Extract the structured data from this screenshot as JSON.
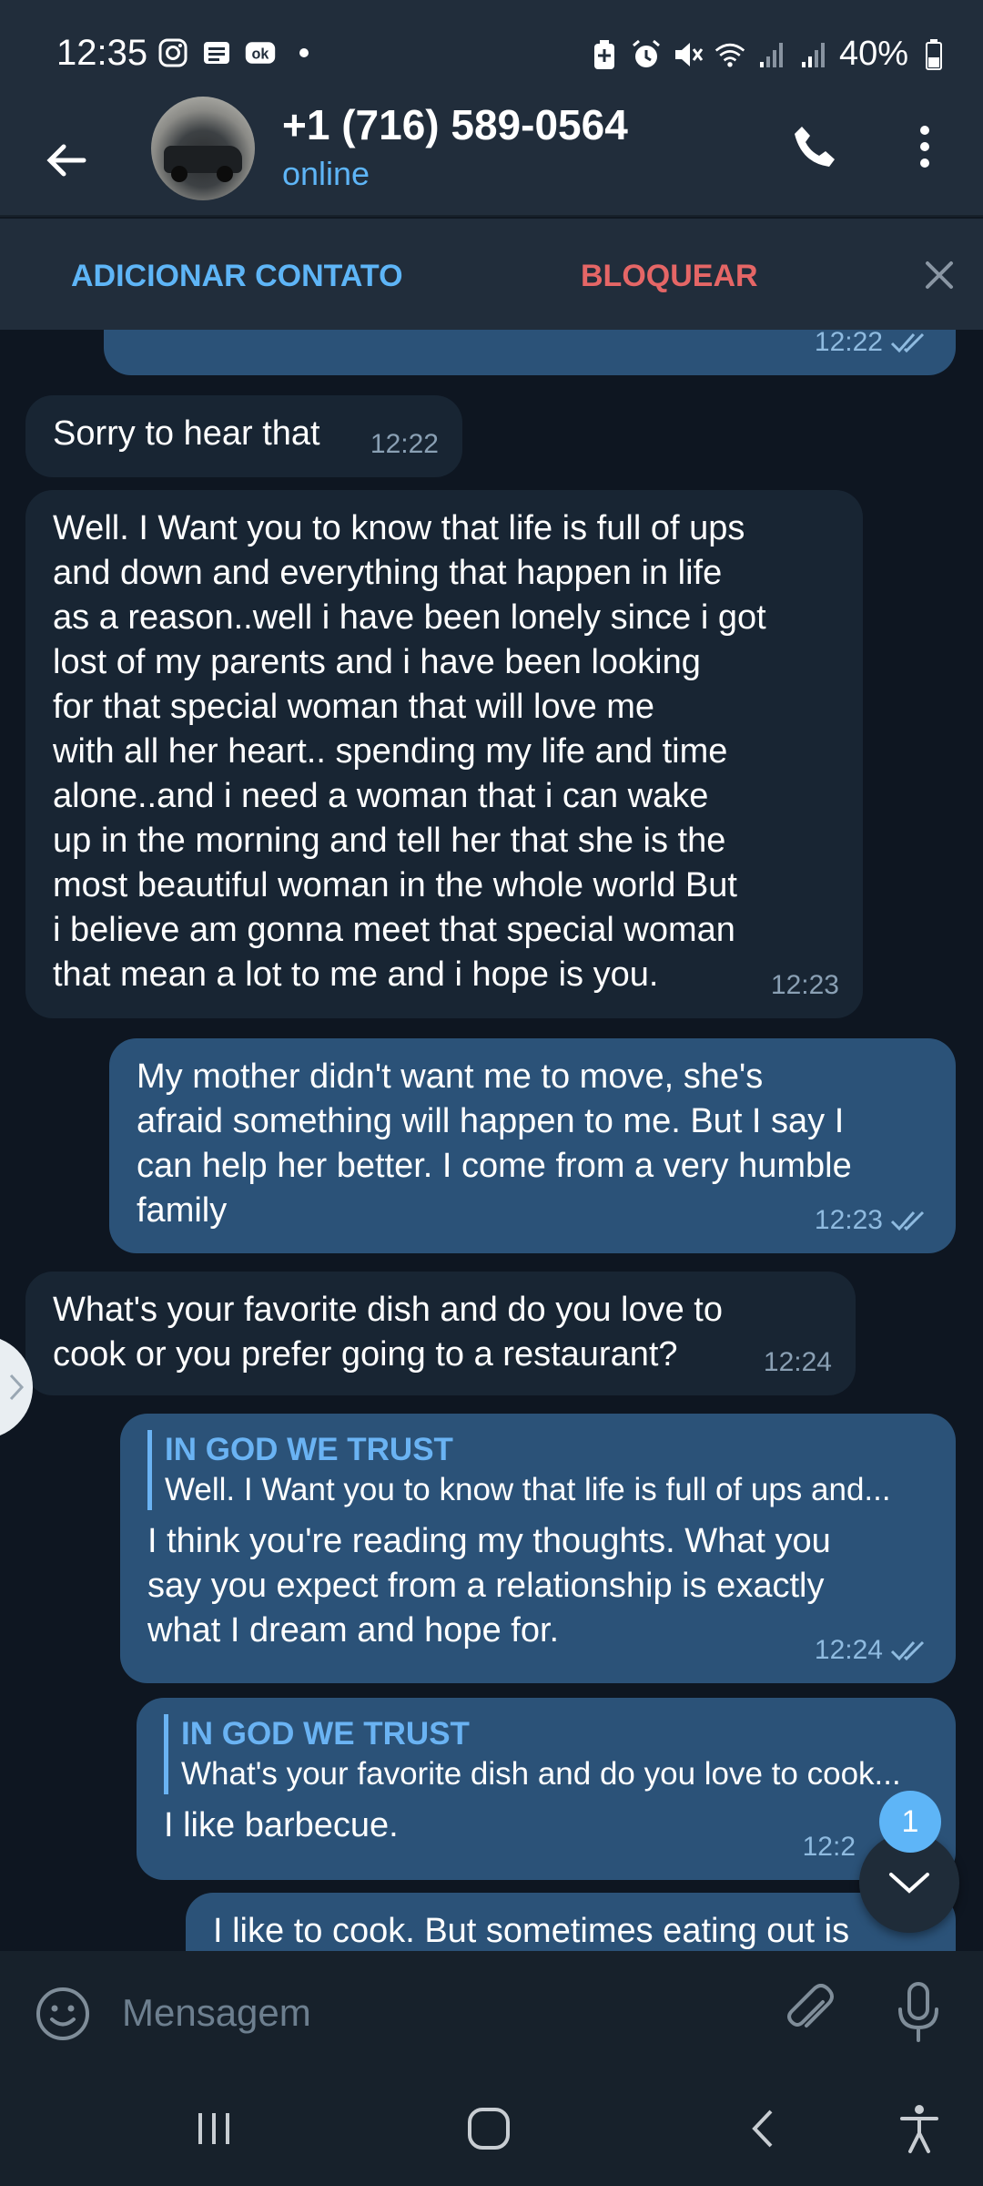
{
  "status_bar": {
    "time": "12:35",
    "battery": "40%",
    "icons_left": [
      "instagram-icon",
      "news-icon",
      "ok-icon",
      "dot-icon"
    ],
    "icons_right": [
      "battery-saver-icon",
      "alarm-icon",
      "mute-icon",
      "wifi-icon",
      "signal-icon",
      "signal-icon",
      "battery-icon"
    ]
  },
  "header": {
    "contact_name": "+1 (716) 589-0564",
    "status": "online"
  },
  "actions": {
    "add_contact": "ADICIONAR CONTATO",
    "block": "BLOQUEAR"
  },
  "messages": [
    {
      "dir": "out",
      "text": "",
      "time": "12:22",
      "read": true
    },
    {
      "dir": "in",
      "text": "Sorry to hear that",
      "time": "12:22"
    },
    {
      "dir": "in",
      "text": "Well. I Want you to know that life is full of ups\nand down and everything that happen in life\nas a reason..well i have been lonely since i got\nlost of my parents and  i have been looking\nfor that special woman that will love me\nwith all her heart.. spending my life and time\nalone..and i need a woman that i can wake\nup in the morning and tell her that she is the\nmost beautiful woman in the whole world  But\ni believe am gonna meet that special woman\nthat mean a lot to me and i hope is you.",
      "time": "12:23"
    },
    {
      "dir": "out",
      "text": "My mother didn't want me to move, she's\nafraid something will happen to me. But I say I\ncan help her better. I come from a very humble\nfamily",
      "time": "12:23",
      "read": true
    },
    {
      "dir": "in",
      "text": "What's your favorite dish and do you love to\ncook or you prefer going to a restaurant?",
      "time": "12:24"
    },
    {
      "dir": "out",
      "quote_author": "IN GOD WE TRUST",
      "quote_text": "Well. I Want you to know that life is full of ups and...",
      "text": "I think you're reading my thoughts. What you\nsay you expect from a relationship is exactly\nwhat I dream and hope for.",
      "time": "12:24",
      "read": true
    },
    {
      "dir": "out",
      "quote_author": "IN GOD WE TRUST",
      "quote_text": "What's your favorite dish and do you love to cook...",
      "text": "I like barbecue.",
      "time": "12:2"
    },
    {
      "dir": "out",
      "text": "I like to cook. But sometimes eating out is",
      "time": ""
    }
  ],
  "scroll_down": {
    "unread_count": "1"
  },
  "composer": {
    "placeholder": "Mensagem"
  }
}
